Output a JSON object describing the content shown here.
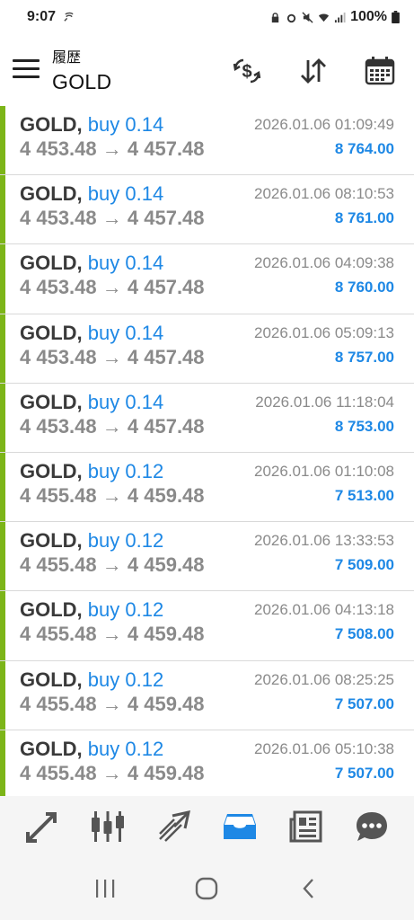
{
  "status": {
    "time": "9:07",
    "battery": "100%"
  },
  "header": {
    "subtitle": "履歴",
    "title": "GOLD",
    "icons": [
      "currency-exchange-icon",
      "sort-icon",
      "calendar-icon"
    ]
  },
  "trades": [
    {
      "symbol": "GOLD,",
      "type": "buy 0.14",
      "open": "4 453.48",
      "close": "4 457.48",
      "time": "2026.01.06 01:09:49",
      "profit": "8 764.00"
    },
    {
      "symbol": "GOLD,",
      "type": "buy 0.14",
      "open": "4 453.48",
      "close": "4 457.48",
      "time": "2026.01.06 08:10:53",
      "profit": "8 761.00"
    },
    {
      "symbol": "GOLD,",
      "type": "buy 0.14",
      "open": "4 453.48",
      "close": "4 457.48",
      "time": "2026.01.06 04:09:38",
      "profit": "8 760.00"
    },
    {
      "symbol": "GOLD,",
      "type": "buy 0.14",
      "open": "4 453.48",
      "close": "4 457.48",
      "time": "2026.01.06 05:09:13",
      "profit": "8 757.00"
    },
    {
      "symbol": "GOLD,",
      "type": "buy 0.14",
      "open": "4 453.48",
      "close": "4 457.48",
      "time": "2026.01.06 11:18:04",
      "profit": "8 753.00"
    },
    {
      "symbol": "GOLD,",
      "type": "buy 0.12",
      "open": "4 455.48",
      "close": "4 459.48",
      "time": "2026.01.06 01:10:08",
      "profit": "7 513.00"
    },
    {
      "symbol": "GOLD,",
      "type": "buy 0.12",
      "open": "4 455.48",
      "close": "4 459.48",
      "time": "2026.01.06 13:33:53",
      "profit": "7 509.00"
    },
    {
      "symbol": "GOLD,",
      "type": "buy 0.12",
      "open": "4 455.48",
      "close": "4 459.48",
      "time": "2026.01.06 04:13:18",
      "profit": "7 508.00"
    },
    {
      "symbol": "GOLD,",
      "type": "buy 0.12",
      "open": "4 455.48",
      "close": "4 459.48",
      "time": "2026.01.06 08:25:25",
      "profit": "7 507.00"
    },
    {
      "symbol": "GOLD,",
      "type": "buy 0.12",
      "open": "4 455.48",
      "close": "4 459.48",
      "time": "2026.01.06 05:10:38",
      "profit": "7 507.00"
    }
  ],
  "arrow": "→",
  "tabs": [
    {
      "name": "quotes-icon",
      "active": false
    },
    {
      "name": "chart-icon",
      "active": false
    },
    {
      "name": "trade-icon",
      "active": false
    },
    {
      "name": "history-icon",
      "active": true
    },
    {
      "name": "news-icon",
      "active": false
    },
    {
      "name": "messages-icon",
      "active": false
    }
  ],
  "colors": {
    "accent": "#1e88e5",
    "buy_bar": "#7cb518",
    "muted": "#8a8a8a"
  }
}
